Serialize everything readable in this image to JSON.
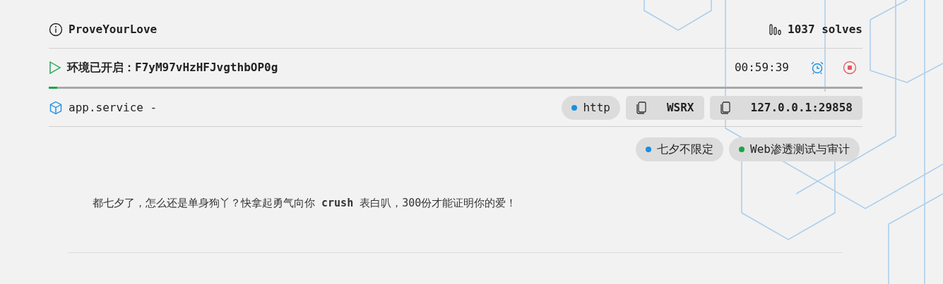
{
  "challenge": {
    "title": "ProveYourLove",
    "solves": "1037 solves"
  },
  "environment": {
    "status": "环境已开启：F7yM97vHzHFJvgthbOP0g",
    "timer": "00:59:39",
    "level": 0.01
  },
  "service": {
    "name": "app.service -",
    "badges": [
      {
        "kind": "protocol",
        "text": "http",
        "color": "#1a8fe3"
      },
      {
        "kind": "copy",
        "text": "WSRX"
      },
      {
        "kind": "copy",
        "text": "127.0.0.1:29858"
      }
    ]
  },
  "tags": [
    {
      "text": "七夕不限定",
      "color": "#1a8fe3"
    },
    {
      "text": "Web渗透测试与审计",
      "color": "#1aa54a"
    }
  ],
  "description": "都七夕了，怎么还是单身狗丫？快拿起勇气向你 **crush** 表白叭，300份才能证明你的爱！"
}
